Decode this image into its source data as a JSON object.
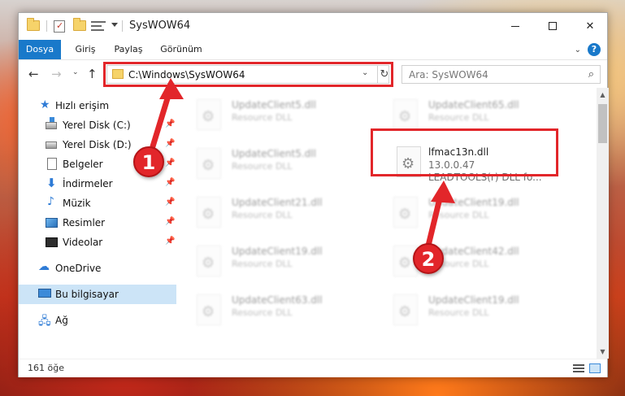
{
  "window": {
    "title": "SysWOW64"
  },
  "ribbon": {
    "tabs": [
      "Dosya",
      "Giriş",
      "Paylaş",
      "Görünüm"
    ],
    "help": "?"
  },
  "address": {
    "path": "C:\\Windows\\SysWOW64",
    "refresh": "↻"
  },
  "search": {
    "placeholder": "Ara: SysWOW64"
  },
  "sidebar": {
    "items": [
      {
        "label": "Hızlı erişim"
      },
      {
        "label": "Yerel Disk (C:)"
      },
      {
        "label": "Yerel Disk (D:)"
      },
      {
        "label": "Belgeler"
      },
      {
        "label": "İndirmeler"
      },
      {
        "label": "Müzik"
      },
      {
        "label": "Resimler"
      },
      {
        "label": "Videolar"
      },
      {
        "label": "OneDrive"
      },
      {
        "label": "Bu bilgisayar"
      },
      {
        "label": "Ağ"
      }
    ]
  },
  "files": [
    {
      "name": "UpdateClient5.dll",
      "desc": "Resource DLL"
    },
    {
      "name": "UpdateClient65.dll",
      "desc": "Resource DLL"
    },
    {
      "name": "UpdateClient5.dll",
      "desc": "Resource DLL"
    },
    {
      "name": "lfmac13n.dll",
      "version": "13.0.0.47",
      "desc": "LEADTOOLS(r) DLL fo..."
    },
    {
      "name": "UpdateClient21.dll",
      "desc": "Resource DLL"
    },
    {
      "name": "UpdateClient19.dll",
      "desc": "Resource DLL"
    },
    {
      "name": "UpdateClient19.dll",
      "desc": "Resource DLL"
    },
    {
      "name": "UpdateClient42.dll",
      "desc": "Resource DLL"
    },
    {
      "name": "UpdateClient63.dll",
      "desc": "Resource DLL"
    },
    {
      "name": "UpdateClient19.dll",
      "desc": "Resource DLL"
    }
  ],
  "status": {
    "count": "161 öğe"
  },
  "annotations": {
    "step1": "1",
    "step2": "2",
    "color": "#e2262a"
  }
}
